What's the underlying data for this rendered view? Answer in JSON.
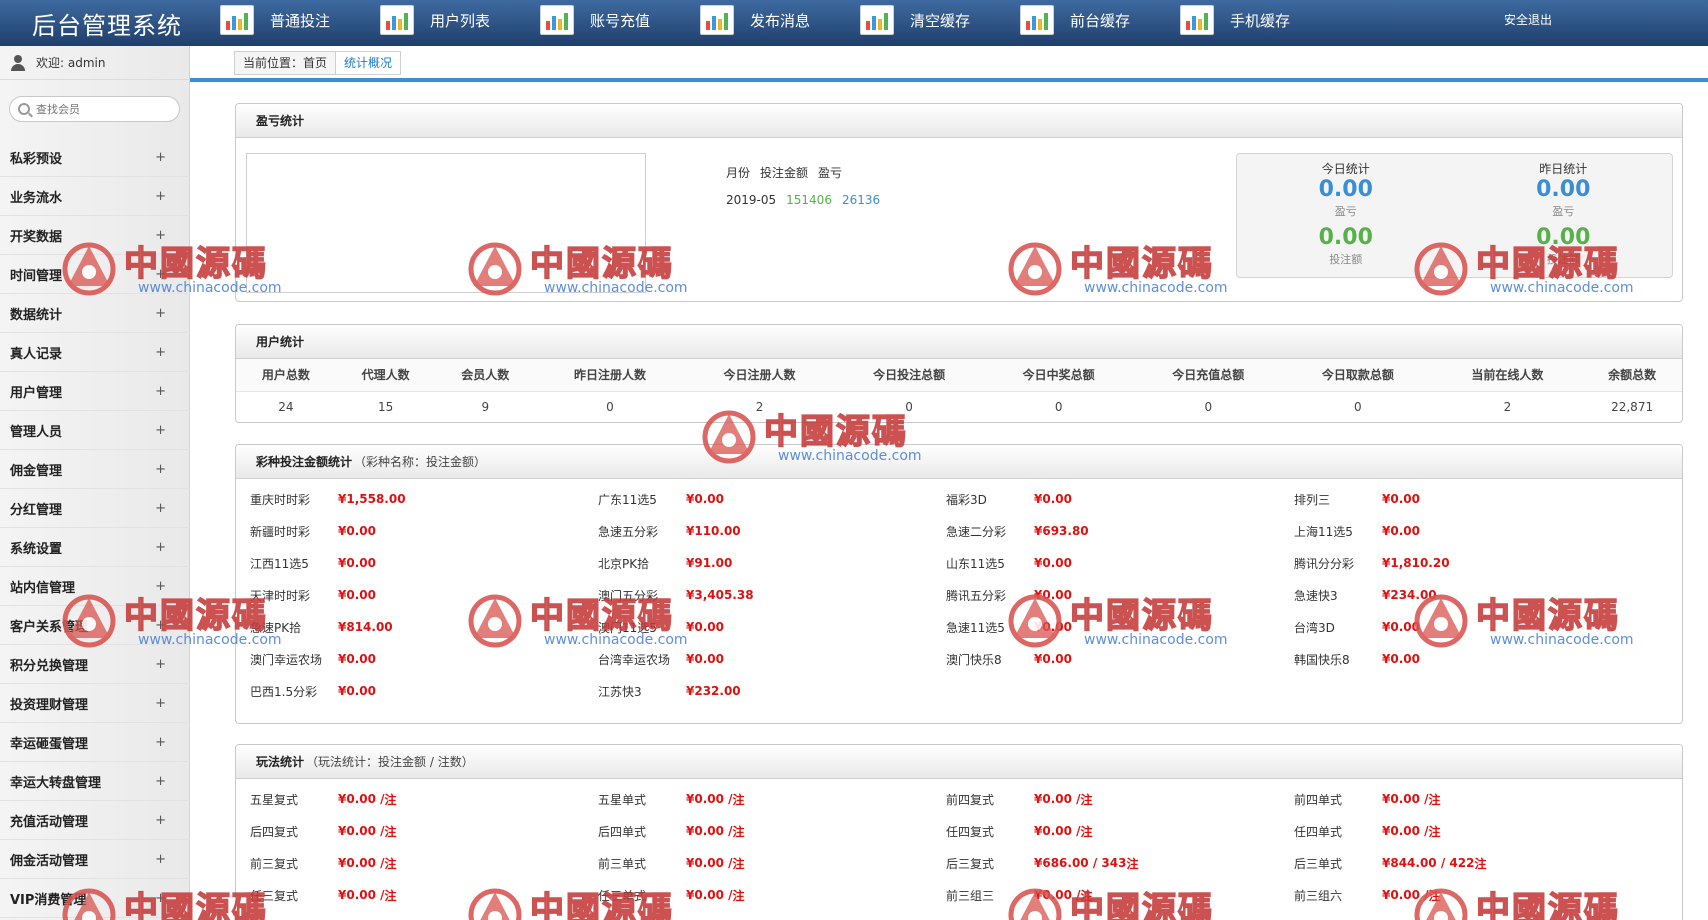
{
  "app": {
    "title": "后台管理系统",
    "logout": "安全退出"
  },
  "top_nav": [
    {
      "label": "普通投注",
      "icon": "chart-icon"
    },
    {
      "label": "用户列表",
      "icon": "chart-icon"
    },
    {
      "label": "账号充值",
      "icon": "chart-icon"
    },
    {
      "label": "发布消息",
      "icon": "chart-icon"
    },
    {
      "label": "清空缓存",
      "icon": "chart-icon"
    },
    {
      "label": "前台缓存",
      "icon": "chart-icon"
    },
    {
      "label": "手机缓存",
      "icon": "chart-icon"
    }
  ],
  "sidebar": {
    "welcome": "欢迎: admin",
    "search_placeholder": "查找会员",
    "menu": [
      "私彩预设",
      "业务流水",
      "开奖数据",
      "时间管理",
      "数据统计",
      "真人记录",
      "用户管理",
      "管理人员",
      "佣金管理",
      "分红管理",
      "系统设置",
      "站内信管理",
      "客户关系管理",
      "积分兑换管理",
      "投资理财管理",
      "幸运砸蛋管理",
      "幸运大转盘管理",
      "充值活动管理",
      "佣金活动管理",
      "VIP消费管理"
    ],
    "expand_symbol": "+"
  },
  "breadcrumb": {
    "prefix": "当前位置：首页",
    "current": "统计概况"
  },
  "profit_panel": {
    "title": "盈亏统计",
    "table_headers": [
      "月份",
      "投注金额",
      "盈亏"
    ],
    "rows": [
      {
        "month": "2019-05",
        "bet": "151406",
        "profit": "26136"
      }
    ],
    "today": {
      "title": "今日统计",
      "profit": "0.00",
      "profit_label": "盈亏",
      "bet": "0.00",
      "bet_label": "投注额"
    },
    "yesterday": {
      "title": "昨日统计",
      "profit": "0.00",
      "profit_label": "盈亏",
      "bet": "0.00",
      "bet_label": "投注额"
    }
  },
  "user_panel": {
    "title": "用户统计",
    "headers": [
      "用户总数",
      "代理人数",
      "会员人数",
      "昨日注册人数",
      "今日注册人数",
      "今日投注总额",
      "今日中奖总额",
      "今日充值总额",
      "今日取款总额",
      "当前在线人数",
      "余额总数"
    ],
    "values": [
      "24",
      "15",
      "9",
      "0",
      "2",
      "0",
      "0",
      "0",
      "0",
      "2",
      "22,871"
    ]
  },
  "lottery_panel": {
    "title": "彩种投注金额统计",
    "subtitle": "（彩种名称：投注金额）",
    "items": [
      {
        "name": "重庆时时彩",
        "value": "¥1,558.00"
      },
      {
        "name": "广东11选5",
        "value": "¥0.00"
      },
      {
        "name": "福彩3D",
        "value": "¥0.00"
      },
      {
        "name": "排列三",
        "value": "¥0.00"
      },
      {
        "name": "新疆时时彩",
        "value": "¥0.00"
      },
      {
        "name": "急速五分彩",
        "value": "¥110.00"
      },
      {
        "name": "急速二分彩",
        "value": "¥693.80"
      },
      {
        "name": "上海11选5",
        "value": "¥0.00"
      },
      {
        "name": "江西11选5",
        "value": "¥0.00"
      },
      {
        "name": "北京PK拾",
        "value": "¥91.00"
      },
      {
        "name": "山东11选5",
        "value": "¥0.00"
      },
      {
        "name": "腾讯分分彩",
        "value": "¥1,810.20"
      },
      {
        "name": "天津时时彩",
        "value": "¥0.00"
      },
      {
        "name": "澳门五分彩",
        "value": "¥3,405.38"
      },
      {
        "name": "腾讯五分彩",
        "value": "¥0.00"
      },
      {
        "name": "急速快3",
        "value": "¥234.00"
      },
      {
        "name": "急速PK拾",
        "value": "¥814.00"
      },
      {
        "name": "澳门11选5",
        "value": "¥0.00"
      },
      {
        "name": "急速11选5",
        "value": "¥0.00"
      },
      {
        "name": "台湾3D",
        "value": "¥0.00"
      },
      {
        "name": "澳门幸运农场",
        "value": "¥0.00"
      },
      {
        "name": "台湾幸运农场",
        "value": "¥0.00"
      },
      {
        "name": "澳门快乐8",
        "value": "¥0.00"
      },
      {
        "name": "韩国快乐8",
        "value": "¥0.00"
      },
      {
        "name": "巴西1.5分彩",
        "value": "¥0.00"
      },
      {
        "name": "江苏快3",
        "value": "¥232.00"
      }
    ]
  },
  "play_panel": {
    "title": "玩法统计",
    "subtitle": "（玩法统计：投注金额 / 注数）",
    "items": [
      {
        "name": "五星复式",
        "value": "¥0.00 / ",
        "unit": "注"
      },
      {
        "name": "五星单式",
        "value": "¥0.00 / ",
        "unit": "注"
      },
      {
        "name": "前四复式",
        "value": "¥0.00 / ",
        "unit": "注"
      },
      {
        "name": "前四单式",
        "value": "¥0.00 / ",
        "unit": "注"
      },
      {
        "name": "后四复式",
        "value": "¥0.00 / ",
        "unit": "注"
      },
      {
        "name": "后四单式",
        "value": "¥0.00 / ",
        "unit": "注"
      },
      {
        "name": "任四复式",
        "value": "¥0.00 / ",
        "unit": "注"
      },
      {
        "name": "任四单式",
        "value": "¥0.00 / ",
        "unit": "注"
      },
      {
        "name": "前三复式",
        "value": "¥0.00 / ",
        "unit": "注"
      },
      {
        "name": "前三单式",
        "value": "¥0.00 / ",
        "unit": "注"
      },
      {
        "name": "后三复式",
        "value": "¥686.00 / 343",
        "unit": "注"
      },
      {
        "name": "后三单式",
        "value": "¥844.00 / 422",
        "unit": "注"
      },
      {
        "name": "任三复式",
        "value": "¥0.00 / ",
        "unit": "注"
      },
      {
        "name": "任三单式",
        "value": "¥0.00 / ",
        "unit": "注"
      },
      {
        "name": "前三组三",
        "value": "¥0.00 / ",
        "unit": "注"
      },
      {
        "name": "前三组六",
        "value": "¥0.00 / ",
        "unit": "注"
      }
    ]
  },
  "watermark": {
    "brand": "中國源碼",
    "url": "www.chinacode.com",
    "color": "#c63a3a"
  }
}
